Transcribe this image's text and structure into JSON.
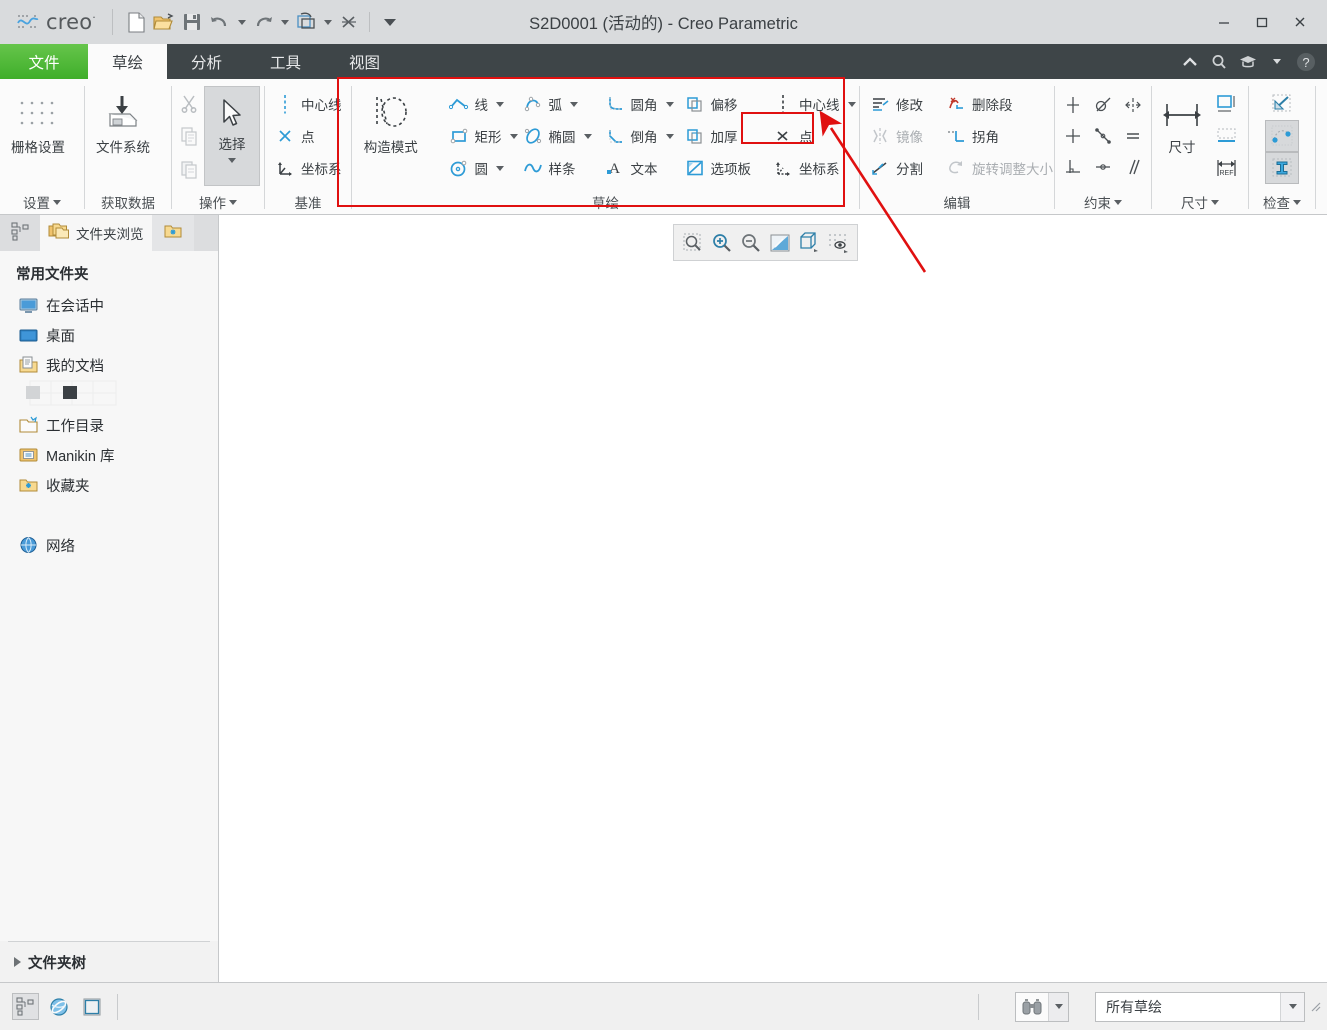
{
  "window": {
    "title": "S2D0001 (活动的) - Creo Parametric",
    "logo_text": "creo",
    "logo_sup": "·",
    "minimize": "−",
    "maximize": "□",
    "close": "×"
  },
  "quick_access": {
    "items": [
      {
        "name": "new-file-icon",
        "label": "新建"
      },
      {
        "name": "open-file-icon",
        "label": "打开"
      },
      {
        "name": "save-icon",
        "label": "保存"
      },
      {
        "name": "undo-icon",
        "label": "撤消"
      },
      {
        "name": "redo-icon",
        "label": "重做"
      },
      {
        "name": "regenerate-icon",
        "label": "重新生成"
      },
      {
        "name": "close-window-icon",
        "label": "关闭"
      },
      {
        "name": "qat-overflow-icon",
        "label": "自定义快速访问工具栏"
      }
    ]
  },
  "tabs": [
    {
      "label": "文件",
      "key": "file"
    },
    {
      "label": "草绘",
      "key": "sketch"
    },
    {
      "label": "分析",
      "key": "analysis"
    },
    {
      "label": "工具",
      "key": "tools"
    },
    {
      "label": "视图",
      "key": "view"
    }
  ],
  "tab_right": [
    {
      "name": "collapse-ribbon-icon",
      "label": "最小化功能区"
    },
    {
      "name": "search-icon",
      "label": "搜索"
    },
    {
      "name": "learning-icon",
      "label": "学习连接"
    },
    {
      "name": "help-dropdown-icon",
      "label": "帮助菜单"
    },
    {
      "name": "help-icon",
      "label": "帮助"
    }
  ],
  "ribbon": {
    "groups": [
      {
        "key": "settings",
        "label": "设置",
        "has_dialog_caret": true,
        "big_buttons": [
          {
            "name": "grid-settings-button",
            "label": "栅格设置",
            "icon": "grid-icon"
          }
        ]
      },
      {
        "key": "get_data",
        "label": "获取数据",
        "has_dialog_caret": false,
        "big_buttons": [
          {
            "name": "file-system-button",
            "label": "文件系统",
            "icon": "file-system-icon"
          }
        ]
      },
      {
        "key": "operations",
        "label": "操作",
        "has_dialog_caret": true,
        "clipboard": [
          {
            "name": "cut-button",
            "label": "剪切",
            "icon": "scissors-icon",
            "disabled": true
          },
          {
            "name": "copy-button",
            "label": "复制",
            "icon": "copy-icon",
            "disabled": true
          },
          {
            "name": "paste-button",
            "label": "粘贴",
            "icon": "paste-icon",
            "disabled": true
          }
        ],
        "select": {
          "name": "select-button",
          "label": "选择",
          "icon": "arrow-cursor-icon"
        }
      },
      {
        "key": "datum",
        "label": "基准",
        "has_dialog_caret": false,
        "items": [
          {
            "name": "centerline-datum-button",
            "label": "中心线",
            "icon": "centerline-icon"
          },
          {
            "name": "point-datum-button",
            "label": "点",
            "icon": "point-icon"
          },
          {
            "name": "coord-system-datum-button",
            "label": "坐标系",
            "icon": "csys-icon"
          }
        ]
      },
      {
        "key": "sketching",
        "label": "草绘",
        "has_dialog_caret": false,
        "construction": {
          "name": "construction-mode-button",
          "label": "构造模式",
          "icon": "construction-mode-icon"
        },
        "col1": [
          {
            "name": "line-button",
            "label": "线",
            "icon": "line-icon",
            "dropdown": true
          },
          {
            "name": "rectangle-button",
            "label": "矩形",
            "icon": "rectangle-icon",
            "dropdown": true
          },
          {
            "name": "circle-button",
            "label": "圆",
            "icon": "circle-icon",
            "dropdown": true
          }
        ],
        "col2": [
          {
            "name": "arc-button",
            "label": "弧",
            "icon": "arc-icon",
            "dropdown": true
          },
          {
            "name": "ellipse-button",
            "label": "椭圆",
            "icon": "ellipse-icon",
            "dropdown": true
          },
          {
            "name": "spline-button",
            "label": "样条",
            "icon": "spline-icon",
            "dropdown": false
          }
        ],
        "col3": [
          {
            "name": "fillet-button",
            "label": "圆角",
            "icon": "fillet-icon",
            "dropdown": true
          },
          {
            "name": "chamfer-button",
            "label": "倒角",
            "icon": "chamfer-icon",
            "dropdown": true
          },
          {
            "name": "text-button",
            "label": "文本",
            "icon": "text-icon",
            "dropdown": false
          }
        ],
        "col4": [
          {
            "name": "offset-button",
            "label": "偏移",
            "icon": "offset-icon",
            "dropdown": false
          },
          {
            "name": "thicken-button",
            "label": "加厚",
            "icon": "thicken-icon",
            "dropdown": false
          },
          {
            "name": "palette-button",
            "label": "选项板",
            "icon": "palette-icon",
            "dropdown": false
          }
        ],
        "col5": [
          {
            "name": "centerline-button",
            "label": "中心线",
            "icon": "centerline-icon",
            "dropdown": true
          },
          {
            "name": "point-button",
            "label": "点",
            "icon": "point-icon",
            "dropdown": false,
            "highlighted": true
          },
          {
            "name": "coord-system-button",
            "label": "坐标系",
            "icon": "csys-icon",
            "dropdown": false
          }
        ]
      },
      {
        "key": "editing",
        "label": "编辑",
        "has_dialog_caret": false,
        "col1": [
          {
            "name": "modify-button",
            "label": "修改",
            "icon": "modify-icon",
            "disabled": false
          },
          {
            "name": "mirror-button",
            "label": "镜像",
            "icon": "mirror-icon",
            "disabled": true
          },
          {
            "name": "divide-button",
            "label": "分割",
            "icon": "divide-icon",
            "disabled": false
          }
        ],
        "col2": [
          {
            "name": "delete-segment-button",
            "label": "删除段",
            "icon": "delete-segment-icon",
            "disabled": false
          },
          {
            "name": "corner-button",
            "label": "拐角",
            "icon": "corner-icon",
            "disabled": false
          },
          {
            "name": "rotate-resize-button",
            "label": "旋转调整大小",
            "icon": "rotate-resize-icon",
            "disabled": true
          }
        ]
      },
      {
        "key": "constrain",
        "label": "约束",
        "has_dialog_caret": true,
        "icons": [
          {
            "name": "vertical-constraint-icon",
            "label": "竖直"
          },
          {
            "name": "tangent-constraint-icon",
            "label": "相切"
          },
          {
            "name": "symmetric-constraint-icon",
            "label": "对称"
          },
          {
            "name": "horizontal-constraint-icon",
            "label": "水平"
          },
          {
            "name": "midpoint-constraint-icon",
            "label": "中点"
          },
          {
            "name": "equal-constraint-icon",
            "label": "相等"
          },
          {
            "name": "perpendicular-constraint-icon",
            "label": "垂直"
          },
          {
            "name": "coincident-constraint-icon",
            "label": "重合"
          },
          {
            "name": "parallel-constraint-icon",
            "label": "平行"
          }
        ]
      },
      {
        "key": "dimension",
        "label": "尺寸",
        "has_dialog_caret": true,
        "big_button": {
          "name": "dimension-button",
          "label": "尺寸",
          "icon": "dimension-icon"
        },
        "icons": [
          {
            "name": "perimeter-dimension-icon",
            "label": "周长"
          },
          {
            "name": "baseline-dimension-icon",
            "label": "基线"
          },
          {
            "name": "reference-dimension-icon",
            "label": "参考"
          }
        ]
      },
      {
        "key": "inspect",
        "label": "检查",
        "has_dialog_caret": true,
        "icons": [
          {
            "name": "overlapping-geometry-icon",
            "label": "重叠几何",
            "active": false
          },
          {
            "name": "highlight-open-ends-icon",
            "label": "加亮开放端",
            "active": true
          },
          {
            "name": "shade-closed-loops-icon",
            "label": "着色封闭环",
            "active": true
          }
        ]
      }
    ]
  },
  "nav": {
    "tabs": [
      {
        "name": "model-tree-tab",
        "label": "",
        "icon": "model-tree-icon",
        "active": false
      },
      {
        "name": "folder-browser-tab",
        "label": "文件夹浏览",
        "icon": "folder-browser-icon",
        "active": true
      },
      {
        "name": "favorites-tab",
        "label": "",
        "icon": "favorites-folder-icon",
        "active": false
      }
    ],
    "header": "常用文件夹",
    "items": [
      {
        "name": "in-session-item",
        "label": "在会话中",
        "icon": "monitor-icon"
      },
      {
        "name": "desktop-item",
        "label": "桌面",
        "icon": "desktop-icon"
      },
      {
        "name": "my-documents-item",
        "label": "我的文档",
        "icon": "documents-icon"
      },
      {
        "name": "unnamed-item",
        "label": "",
        "icon": "swatch-icon"
      },
      {
        "name": "working-directory-item",
        "label": "工作目录",
        "icon": "working-dir-icon"
      },
      {
        "name": "manikin-library-item",
        "label": "Manikin 库",
        "icon": "manikin-icon"
      },
      {
        "name": "favorites-item",
        "label": "收藏夹",
        "icon": "favorites-folder-icon"
      },
      {
        "name": "network-item",
        "label": "网络",
        "icon": "network-icon"
      }
    ],
    "tree_label": "文件夹树"
  },
  "canvas": {
    "zoom_toolbar": [
      {
        "name": "refit-icon",
        "label": "重新调整"
      },
      {
        "name": "zoom-in-icon",
        "label": "放大"
      },
      {
        "name": "zoom-out-icon",
        "label": "缩小"
      },
      {
        "name": "repaint-icon",
        "label": "重画"
      },
      {
        "name": "display-style-icon",
        "label": "显示样式"
      },
      {
        "name": "datum-display-icon",
        "label": "基准显示过滤器"
      }
    ]
  },
  "statusbar": {
    "left_buttons": [
      {
        "name": "model-tree-toggle",
        "label": "",
        "icon": "model-tree-icon",
        "active": true
      },
      {
        "name": "browser-toggle",
        "label": "",
        "icon": "browser-globe-icon",
        "active": false
      },
      {
        "name": "fullscreen-toggle",
        "label": "",
        "icon": "fullscreen-icon",
        "active": false
      }
    ],
    "find_button": {
      "name": "find-button",
      "label": "",
      "icon": "binoculars-icon"
    },
    "filter": {
      "name": "selection-filter-select",
      "value": "所有草绘"
    }
  },
  "annotations": {
    "box_point_tool": {
      "name": "highlight-box-point-tool",
      "color": "#e01010"
    },
    "box_sketch_group": {
      "name": "highlight-box-sketch-group",
      "color": "#e01010"
    },
    "arrow": {
      "name": "annotation-arrow",
      "color": "#e01010"
    }
  }
}
